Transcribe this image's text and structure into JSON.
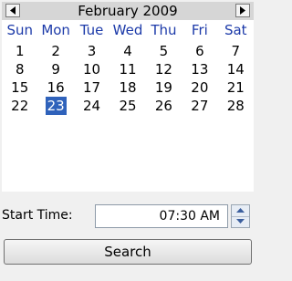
{
  "calendar": {
    "month_title": "February 2009",
    "weekdays": [
      "Sun",
      "Mon",
      "Tue",
      "Wed",
      "Thu",
      "Fri",
      "Sat"
    ],
    "weeks": [
      [
        "1",
        "2",
        "3",
        "4",
        "5",
        "6",
        "7"
      ],
      [
        "8",
        "9",
        "10",
        "11",
        "12",
        "13",
        "14"
      ],
      [
        "15",
        "16",
        "17",
        "18",
        "19",
        "20",
        "21"
      ],
      [
        "22",
        "23",
        "24",
        "25",
        "26",
        "27",
        "28"
      ]
    ],
    "selected_day": "23",
    "prev_icon": "arrow-left-icon",
    "next_icon": "arrow-right-icon",
    "header_color": "#d6d6d6",
    "weekday_color": "#1c3aa9",
    "selected_color": "#2f62bb"
  },
  "start_time": {
    "label": "Start Time:",
    "value": "07:30 AM",
    "spinner_icon": "up-down-spinner-icon"
  },
  "search_button": {
    "label": "Search"
  }
}
